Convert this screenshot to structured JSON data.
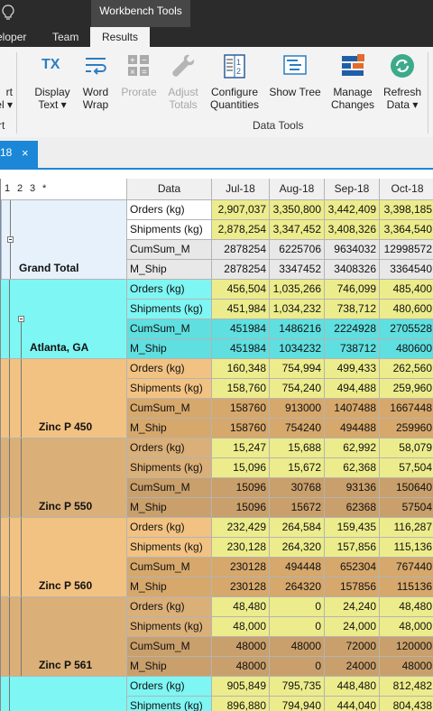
{
  "window": {
    "context_title": "Workbench Tools"
  },
  "tabs": {
    "developer": "eloper",
    "team": "Team",
    "results": "Results"
  },
  "ribbon": {
    "buttons": [
      {
        "key": "level",
        "label1": "rt",
        "label2": "el ▾",
        "icon": "expand-level-icon",
        "disabled": false
      },
      {
        "key": "display-text",
        "label1": "Display",
        "label2": "Text ▾",
        "icon": "tx-icon",
        "disabled": false
      },
      {
        "key": "word-wrap",
        "label1": "Word",
        "label2": "Wrap",
        "icon": "word-wrap-icon",
        "disabled": false
      },
      {
        "key": "prorate",
        "label1": "Prorate",
        "label2": "",
        "icon": "calculator-icon",
        "disabled": true
      },
      {
        "key": "adjust-totals",
        "label1": "Adjust",
        "label2": "Totals",
        "icon": "wrench-icon",
        "disabled": true
      },
      {
        "key": "configure-quantities",
        "label1": "Configure",
        "label2": "Quantities",
        "icon": "quantities-icon",
        "disabled": false
      },
      {
        "key": "show-tree",
        "label1": "Show Tree",
        "label2": "",
        "icon": "tree-icon",
        "disabled": false
      },
      {
        "key": "manage-changes",
        "label1": "Manage",
        "label2": "Changes",
        "icon": "manage-changes-icon",
        "disabled": false
      },
      {
        "key": "refresh-data",
        "label1": "Refresh",
        "label2": "Data ▾",
        "icon": "refresh-icon",
        "disabled": false
      }
    ],
    "groups": {
      "left": "rt",
      "data_tools": "Data Tools"
    },
    "colors": {
      "tx": "#2a7ec2",
      "refresh": "#3daa8a",
      "manage": "#1f5fa8",
      "manage_accent": "#e36b2c"
    }
  },
  "doc_tab": {
    "label": "18",
    "close": "×"
  },
  "grid": {
    "level_buttons": [
      "1",
      "2",
      "3",
      "*"
    ],
    "data_header": "Data",
    "months": [
      "Jul-18",
      "Aug-18",
      "Sep-18",
      "Oct-18"
    ],
    "groups": [
      {
        "name": "Grand Total",
        "style": "grand",
        "rows": [
          {
            "measure": "Orders (kg)",
            "values": [
              "2,907,037",
              "3,350,800",
              "3,442,409",
              "3,398,185"
            ]
          },
          {
            "measure": "Shipments (kg)",
            "values": [
              "2,878,254",
              "3,347,452",
              "3,408,326",
              "3,364,540"
            ]
          },
          {
            "measure": "CumSum_M",
            "values": [
              "2878254",
              "6225706",
              "9634032",
              "12998572"
            ]
          },
          {
            "measure": "M_Ship",
            "values": [
              "2878254",
              "3347452",
              "3408326",
              "3364540"
            ]
          }
        ]
      },
      {
        "name": "Atlanta, GA",
        "style": "city",
        "rows": [
          {
            "measure": "Orders (kg)",
            "values": [
              "456,504",
              "1,035,266",
              "746,099",
              "485,400"
            ]
          },
          {
            "measure": "Shipments (kg)",
            "values": [
              "451,984",
              "1,034,232",
              "738,712",
              "480,600"
            ]
          },
          {
            "measure": "CumSum_M",
            "values": [
              "451984",
              "1486216",
              "2224928",
              "2705528"
            ]
          },
          {
            "measure": "M_Ship",
            "values": [
              "451984",
              "1034232",
              "738712",
              "480600"
            ]
          }
        ]
      },
      {
        "name": "Zinc P 450",
        "style": "product",
        "rows": [
          {
            "measure": "Orders (kg)",
            "values": [
              "160,348",
              "754,994",
              "499,433",
              "262,560"
            ]
          },
          {
            "measure": "Shipments (kg)",
            "values": [
              "158,760",
              "754,240",
              "494,488",
              "259,960"
            ]
          },
          {
            "measure": "CumSum_M",
            "values": [
              "158760",
              "913000",
              "1407488",
              "1667448"
            ]
          },
          {
            "measure": "M_Ship",
            "values": [
              "158760",
              "754240",
              "494488",
              "259960"
            ]
          }
        ]
      },
      {
        "name": "Zinc P 550",
        "style": "product",
        "rows": [
          {
            "measure": "Orders (kg)",
            "values": [
              "15,247",
              "15,688",
              "62,992",
              "58,079"
            ]
          },
          {
            "measure": "Shipments (kg)",
            "values": [
              "15,096",
              "15,672",
              "62,368",
              "57,504"
            ]
          },
          {
            "measure": "CumSum_M",
            "values": [
              "15096",
              "30768",
              "93136",
              "150640"
            ]
          },
          {
            "measure": "M_Ship",
            "values": [
              "15096",
              "15672",
              "62368",
              "57504"
            ]
          }
        ]
      },
      {
        "name": "Zinc P 560",
        "style": "product",
        "rows": [
          {
            "measure": "Orders (kg)",
            "values": [
              "232,429",
              "264,584",
              "159,435",
              "116,287"
            ]
          },
          {
            "measure": "Shipments (kg)",
            "values": [
              "230,128",
              "264,320",
              "157,856",
              "115,136"
            ]
          },
          {
            "measure": "CumSum_M",
            "values": [
              "230128",
              "494448",
              "652304",
              "767440"
            ]
          },
          {
            "measure": "M_Ship",
            "values": [
              "230128",
              "264320",
              "157856",
              "115136"
            ]
          }
        ]
      },
      {
        "name": "Zinc P 561",
        "style": "product",
        "rows": [
          {
            "measure": "Orders (kg)",
            "values": [
              "48,480",
              "0",
              "24,240",
              "48,480"
            ]
          },
          {
            "measure": "Shipments (kg)",
            "values": [
              "48,000",
              "0",
              "24,000",
              "48,000"
            ]
          },
          {
            "measure": "CumSum_M",
            "values": [
              "48000",
              "48000",
              "72000",
              "120000"
            ]
          },
          {
            "measure": "M_Ship",
            "values": [
              "48000",
              "0",
              "24000",
              "48000"
            ]
          }
        ]
      },
      {
        "name": "",
        "style": "city",
        "rows": [
          {
            "measure": "Orders (kg)",
            "values": [
              "905,849",
              "795,735",
              "448,480",
              "812,482"
            ]
          },
          {
            "measure": "Shipments (kg)",
            "values": [
              "896,880",
              "794,940",
              "444,040",
              "804,438"
            ]
          }
        ]
      }
    ],
    "colors": {
      "grand_bg": "#e6f1fb",
      "city_bg": "#7ef6f3",
      "product_bg": "#f2c282",
      "product_bg_alt": "#daaf78",
      "yellow": "#ecec8c",
      "cumsum_light": "#e8e8e8",
      "cumsum_city": "#5fdfe0",
      "cumsum_product": "#d6a86c",
      "cumsum_product_alt": "#c99f6b"
    }
  }
}
